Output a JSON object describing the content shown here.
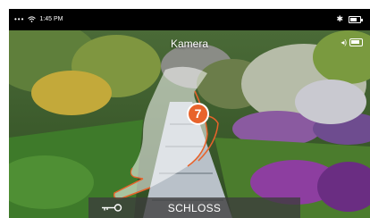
{
  "status_bar": {
    "time": "1:45 PM"
  },
  "header": {
    "title": "Kamera"
  },
  "bottom_bar": {
    "lock_label": "SCHLOSS"
  },
  "instruction": {
    "step_number": "7"
  },
  "colors": {
    "accent": "#e8632b",
    "bar_bg": "#3c3c3c"
  }
}
